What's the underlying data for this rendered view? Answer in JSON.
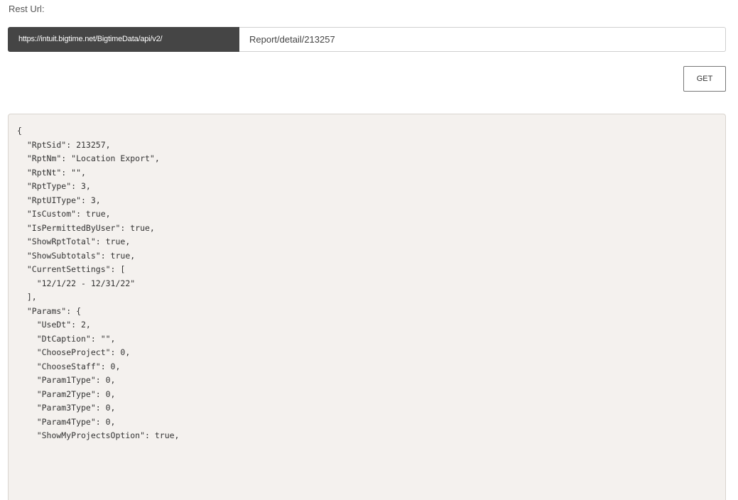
{
  "rest": {
    "label": "Rest Url:",
    "base_url": "https://intuit.bigtime.net/BigtimeData/api/v2/",
    "path": "Report/detail/213257",
    "get_label": "GET"
  },
  "response": {
    "lines": [
      "{",
      "  \"RptSid\": 213257,",
      "  \"RptNm\": \"Location Export\",",
      "  \"RptNt\": \"\",",
      "  \"RptType\": 3,",
      "  \"RptUIType\": 3,",
      "  \"IsCustom\": true,",
      "  \"IsPermittedByUser\": true,",
      "  \"ShowRptTotal\": true,",
      "  \"ShowSubtotals\": true,",
      "  \"CurrentSettings\": [",
      "    \"12/1/22 - 12/31/22\"",
      "  ],",
      "  \"Params\": {",
      "    \"UseDt\": 2,",
      "    \"DtCaption\": \"\",",
      "    \"ChooseProject\": 0,",
      "    \"ChooseStaff\": 0,",
      "    \"Param1Type\": 0,",
      "    \"Param2Type\": 0,",
      "    \"Param3Type\": 0,",
      "    \"Param4Type\": 0,",
      "    \"ShowMyProjectsOption\": true,"
    ]
  }
}
